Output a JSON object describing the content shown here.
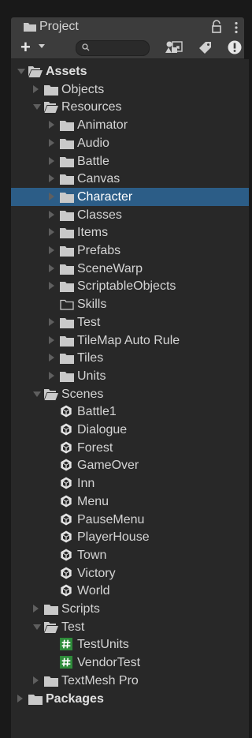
{
  "tab": {
    "title": "Project"
  },
  "toolbar": {
    "search_placeholder": ""
  },
  "tree": [
    {
      "label": "Assets",
      "depth": 0,
      "state": "open",
      "icon": "folder-open-icon",
      "bold": true
    },
    {
      "label": "Objects",
      "depth": 1,
      "state": "closed",
      "icon": "folder-icon"
    },
    {
      "label": "Resources",
      "depth": 1,
      "state": "open",
      "icon": "folder-open-icon"
    },
    {
      "label": "Animator",
      "depth": 2,
      "state": "closed",
      "icon": "folder-icon"
    },
    {
      "label": "Audio",
      "depth": 2,
      "state": "closed",
      "icon": "folder-icon"
    },
    {
      "label": "Battle",
      "depth": 2,
      "state": "closed",
      "icon": "folder-icon"
    },
    {
      "label": "Canvas",
      "depth": 2,
      "state": "closed",
      "icon": "folder-icon"
    },
    {
      "label": "Character",
      "depth": 2,
      "state": "closed",
      "icon": "folder-icon",
      "selected": true
    },
    {
      "label": "Classes",
      "depth": 2,
      "state": "closed",
      "icon": "folder-icon"
    },
    {
      "label": "Items",
      "depth": 2,
      "state": "closed",
      "icon": "folder-icon"
    },
    {
      "label": "Prefabs",
      "depth": 2,
      "state": "closed",
      "icon": "folder-icon"
    },
    {
      "label": "SceneWarp",
      "depth": 2,
      "state": "closed",
      "icon": "folder-icon"
    },
    {
      "label": "ScriptableObjects",
      "depth": 2,
      "state": "closed",
      "icon": "folder-icon"
    },
    {
      "label": "Skills",
      "depth": 2,
      "state": "none",
      "icon": "folder-empty-icon"
    },
    {
      "label": "Test",
      "depth": 2,
      "state": "closed",
      "icon": "folder-icon"
    },
    {
      "label": "TileMap Auto Rule",
      "depth": 2,
      "state": "closed",
      "icon": "folder-icon"
    },
    {
      "label": "Tiles",
      "depth": 2,
      "state": "closed",
      "icon": "folder-icon"
    },
    {
      "label": "Units",
      "depth": 2,
      "state": "closed",
      "icon": "folder-icon"
    },
    {
      "label": "Scenes",
      "depth": 1,
      "state": "open",
      "icon": "folder-open-icon"
    },
    {
      "label": "Battle1",
      "depth": 2,
      "state": "none",
      "icon": "unity-scene-icon"
    },
    {
      "label": "Dialogue",
      "depth": 2,
      "state": "none",
      "icon": "unity-scene-icon"
    },
    {
      "label": "Forest",
      "depth": 2,
      "state": "none",
      "icon": "unity-scene-icon"
    },
    {
      "label": "GameOver",
      "depth": 2,
      "state": "none",
      "icon": "unity-scene-icon"
    },
    {
      "label": "Inn",
      "depth": 2,
      "state": "none",
      "icon": "unity-scene-icon"
    },
    {
      "label": "Menu",
      "depth": 2,
      "state": "none",
      "icon": "unity-scene-icon"
    },
    {
      "label": "PauseMenu",
      "depth": 2,
      "state": "none",
      "icon": "unity-scene-icon"
    },
    {
      "label": "PlayerHouse",
      "depth": 2,
      "state": "none",
      "icon": "unity-scene-icon"
    },
    {
      "label": "Town",
      "depth": 2,
      "state": "none",
      "icon": "unity-scene-icon"
    },
    {
      "label": "Victory",
      "depth": 2,
      "state": "none",
      "icon": "unity-scene-icon"
    },
    {
      "label": "World",
      "depth": 2,
      "state": "none",
      "icon": "unity-scene-icon"
    },
    {
      "label": "Scripts",
      "depth": 1,
      "state": "closed",
      "icon": "folder-icon"
    },
    {
      "label": "Test",
      "depth": 1,
      "state": "open",
      "icon": "folder-open-icon"
    },
    {
      "label": "TestUnits",
      "depth": 2,
      "state": "none",
      "icon": "csharp-script-icon"
    },
    {
      "label": "VendorTest",
      "depth": 2,
      "state": "none",
      "icon": "csharp-script-icon"
    },
    {
      "label": "TextMesh Pro",
      "depth": 1,
      "state": "closed",
      "icon": "folder-icon"
    },
    {
      "label": "Packages",
      "depth": 0,
      "state": "closed",
      "icon": "folder-icon",
      "bold": true
    }
  ],
  "colors": {
    "selection": "#2c5d87",
    "panel": "#282828",
    "script_green": "#2e8b3a"
  }
}
